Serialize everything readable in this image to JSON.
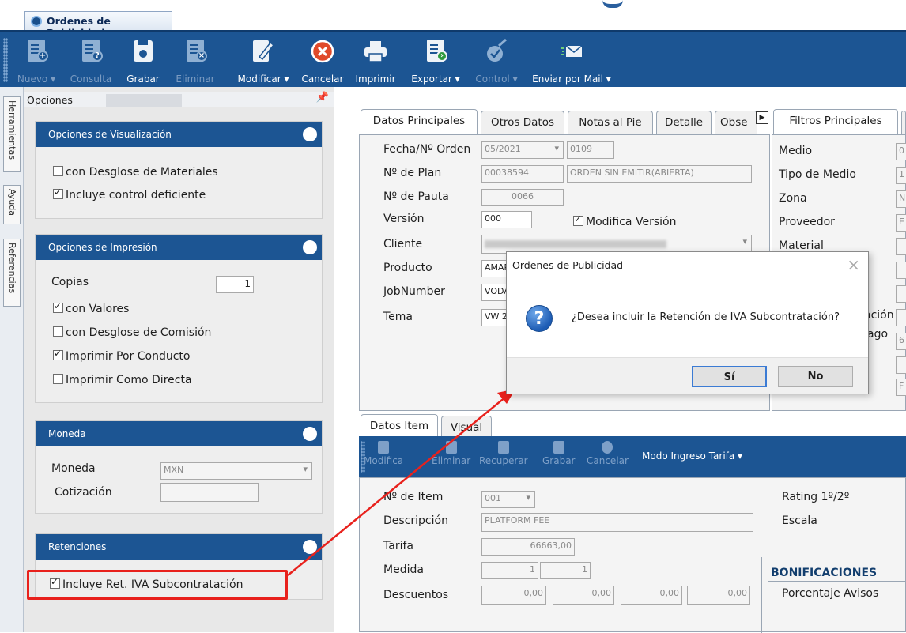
{
  "window_tab": {
    "title": "Ordenes de Publicidad"
  },
  "toolbar": {
    "nuevo": "Nuevo",
    "consulta": "Consulta",
    "grabar": "Grabar",
    "eliminar": "Eliminar",
    "modificar": "Modificar",
    "cancelar": "Cancelar",
    "imprimir": "Imprimir",
    "exportar": "Exportar",
    "control": "Control",
    "enviar_mail": "Enviar por Mail"
  },
  "side_tabs": [
    "Herramientas",
    "Ayuda",
    "Referencias"
  ],
  "options_panel": {
    "title": "Opciones",
    "visualizacion": {
      "header": "Opciones de Visualización",
      "desglose_materiales": "con Desglose de Materiales",
      "control_deficiente": "Incluye control deficiente"
    },
    "impresion": {
      "header": "Opciones de Impresión",
      "copias_label": "Copias",
      "copias_value": "1",
      "con_valores": "con Valores",
      "desglose_comision": "con Desglose de Comisión",
      "por_conducto": "Imprimir Por Conducto",
      "como_directa": "Imprimir Como Directa"
    },
    "moneda": {
      "header": "Moneda",
      "moneda_label": "Moneda",
      "moneda_value": "MXN",
      "cotizacion_label": "Cotización",
      "cotizacion_value": ""
    },
    "retenciones": {
      "header": "Retenciones",
      "ret_iva": "Incluye Ret. IVA Subcontratación"
    }
  },
  "main_tabs": [
    "Datos Principales",
    "Otros Datos",
    "Notas al Pie",
    "Detalle",
    "Obse"
  ],
  "datos_principales": {
    "fecha_label": "Fecha/Nº Orden",
    "fecha_value": "05/2021",
    "orden_value": "0109",
    "plan_label": "Nº de Plan",
    "plan_value": "00038594",
    "plan_status": "ORDEN SIN EMITIR(ABIERTA)",
    "pauta_label": "Nº de Pauta",
    "pauta_value": "0066",
    "version_label": "Versión",
    "version_value": "000",
    "modifica_version": "Modifica Versión",
    "cliente_label": "Cliente",
    "producto_label": "Producto",
    "producto_value": "AMAR",
    "jobnumber_label": "JobNumber",
    "jobnumber_value": "VODA",
    "tema_label": "Tema",
    "tema_value": "VW 2"
  },
  "filtros": {
    "tab": "Filtros Principales",
    "medio": "Medio",
    "medio_value": "0",
    "tipo_medio": "Tipo de Medio",
    "tipo_medio_value": "1",
    "zona": "Zona",
    "zona_value": "N",
    "proveedor": "Proveedor",
    "proveedor_value": "E",
    "material": "Material",
    "partial_a": "ación",
    "partial_b": "ago",
    "partial_b_value": "6",
    "partial_c_value": "F"
  },
  "item_tabs": [
    "Datos Item",
    "Visual"
  ],
  "item_toolbar": {
    "modifica": "Modifica",
    "eliminar": "Eliminar",
    "recuperar": "Recuperar",
    "grabar": "Grabar",
    "cancelar": "Cancelar",
    "modo_tarifa": "Modo Ingreso Tarifa"
  },
  "datos_item": {
    "item_label": "Nº de Item",
    "item_value": "001",
    "descripcion_label": "Descripción",
    "descripcion_value": "PLATFORM FEE",
    "tarifa_label": "Tarifa",
    "tarifa_value": "66663,00",
    "medida_label": "Medida",
    "medida_value1": "1",
    "medida_value2": "1",
    "descuentos_label": "Descuentos",
    "descuentos": [
      "0,00",
      "0,00",
      "0,00",
      "0,00"
    ],
    "rating_label": "Rating 1º/2º",
    "escala_label": "Escala",
    "bonificaciones": "BONIFICACIONES",
    "porcentaje_avisos": "Porcentaje Avisos"
  },
  "dialog": {
    "title": "Ordenes de Publicidad",
    "message": "¿Desea incluir la Retención de IVA Subcontratación?",
    "yes": "Sí",
    "no": "No"
  }
}
